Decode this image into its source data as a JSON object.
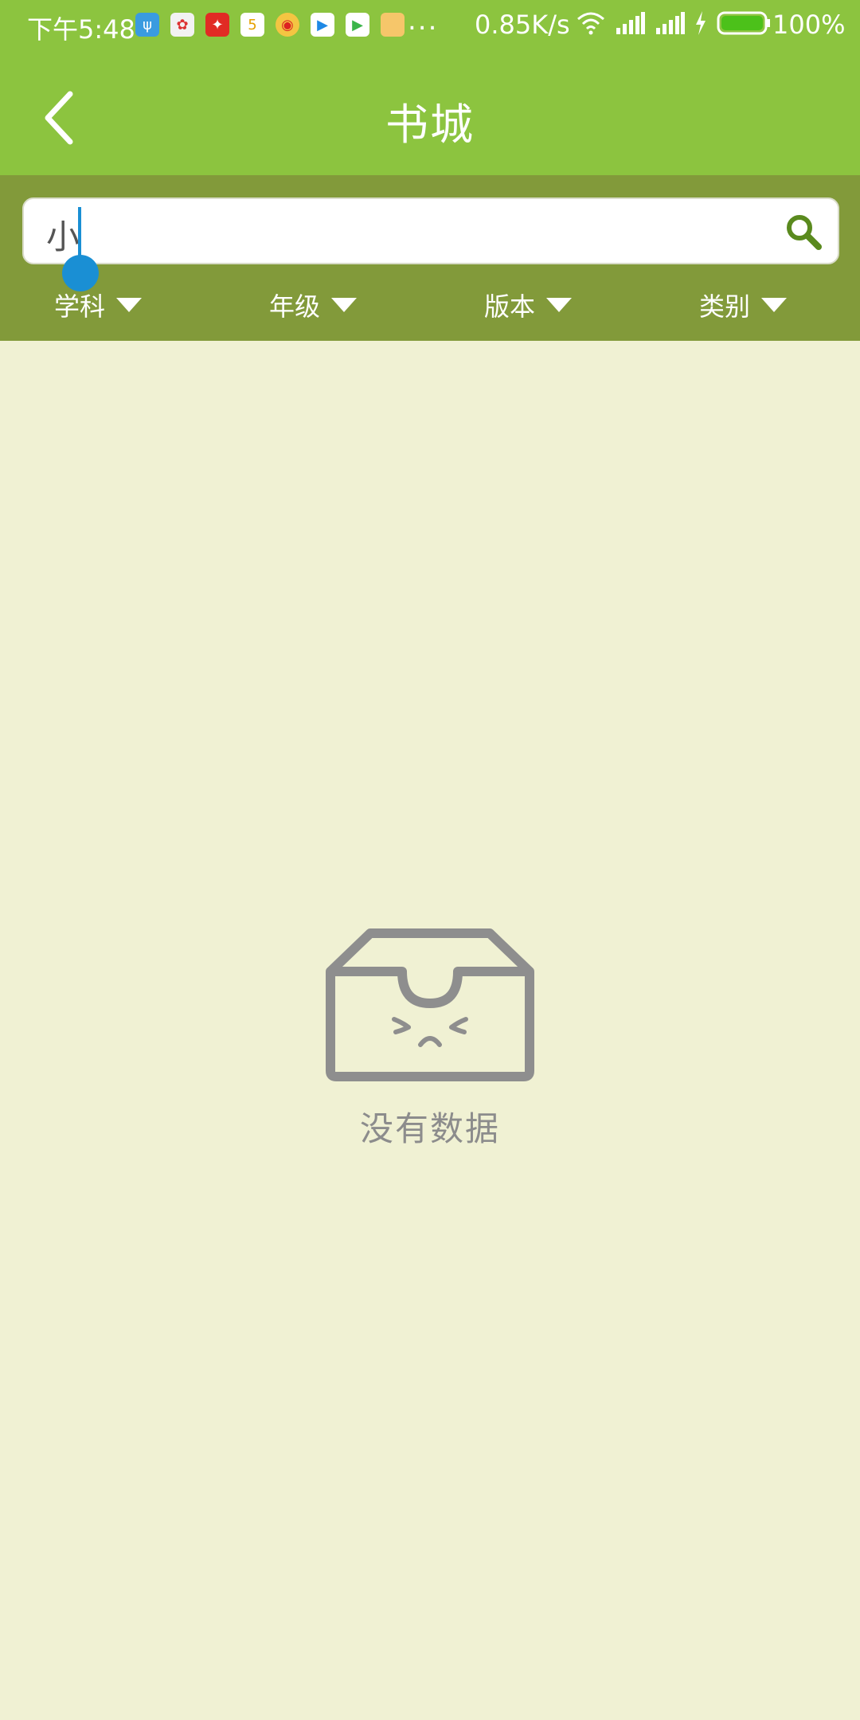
{
  "status_bar": {
    "time": "下午5:48",
    "more": "...",
    "net_speed": "0.85K/s",
    "battery": "100%"
  },
  "header": {
    "title": "书城"
  },
  "search": {
    "value": "小"
  },
  "filters": [
    {
      "label": "学科"
    },
    {
      "label": "年级"
    },
    {
      "label": "版本"
    },
    {
      "label": "类别"
    }
  ],
  "empty": {
    "text": "没有数据"
  },
  "colors": {
    "header_green": "#8cc43f",
    "filter_bar": "#829a3a",
    "background": "#f0f1d3",
    "search_icon": "#5a8a1e",
    "caret": "#1a8fd4"
  }
}
